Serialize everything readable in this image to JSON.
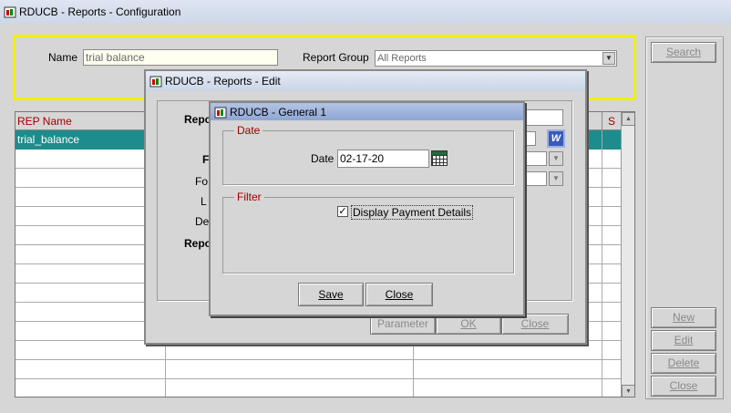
{
  "main_window": {
    "title": "RDUCB - Reports - Configuration",
    "name_label": "Name",
    "name_value": "trial balance",
    "report_group_label": "Report Group",
    "report_group_value": "All Reports",
    "columns": {
      "rep_name": "REP Name",
      "s": "S"
    },
    "rows": [
      "trial_balance"
    ],
    "buttons": {
      "search": "Search",
      "new": "New",
      "edit": "Edit",
      "delete": "Delete",
      "close": "Close"
    }
  },
  "edit_window": {
    "title": "RDUCB - Reports - Edit",
    "labels": {
      "report": "Repo",
      "f": "F",
      "fo": "Fo",
      "l": "L",
      "de": "De",
      "repo2": "Repo"
    },
    "buttons": {
      "parameter": "Parameter",
      "ok": "OK",
      "close": "Close"
    }
  },
  "general_window": {
    "title": "RDUCB - General 1",
    "date_group": "Date",
    "date_label": "Date",
    "date_value": "02-17-20",
    "filter_group": "Filter",
    "checkbox_label": "Display Payment Details",
    "checkbox_checked": true,
    "buttons": {
      "save": "Save",
      "close": "Close"
    }
  },
  "colors": {
    "accent_yellow": "#f0f000",
    "selected_row": "#1e8c8c",
    "label_red": "#a00000"
  }
}
